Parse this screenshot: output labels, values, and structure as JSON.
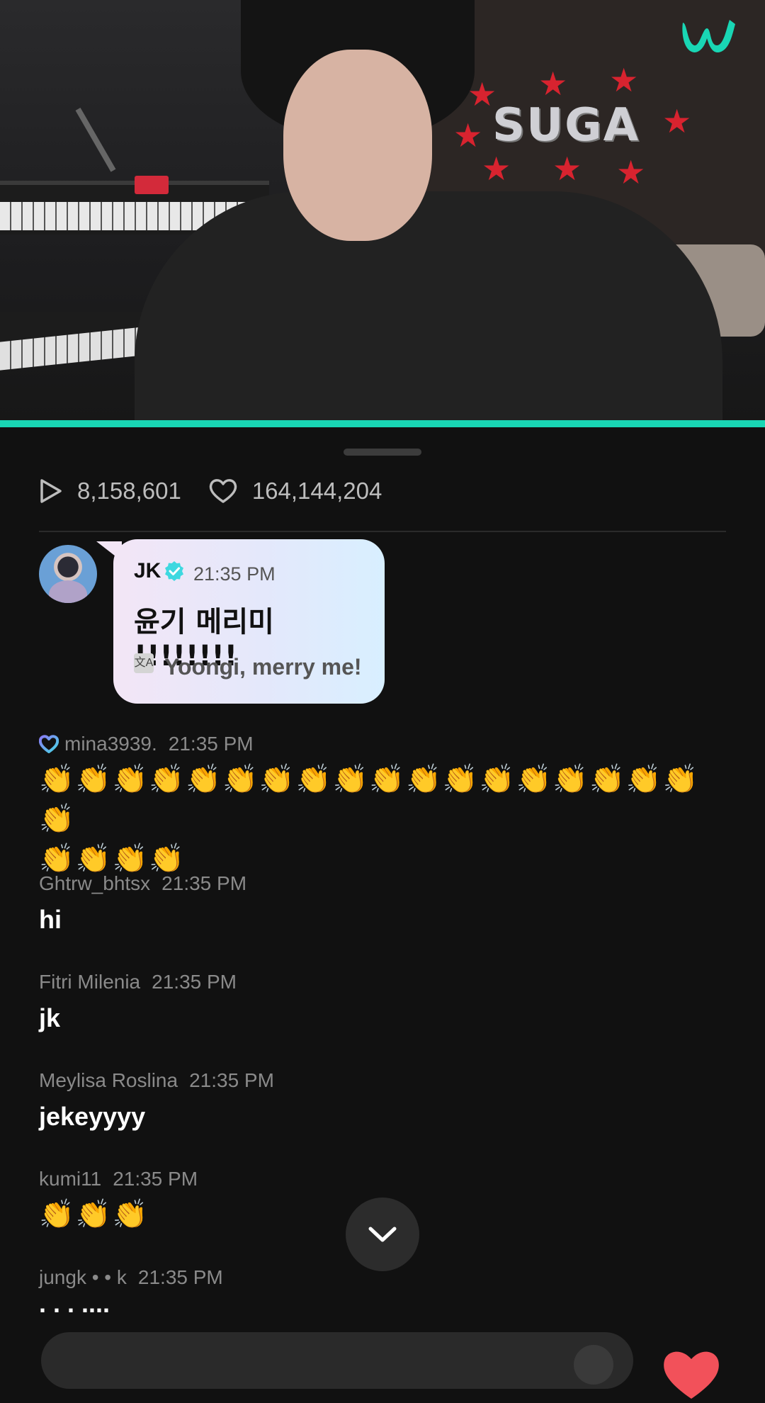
{
  "video": {
    "wall_text": "SUGA",
    "progress_fraction": 1.0,
    "accent_color": "#19d6b4"
  },
  "stats": {
    "views_icon": "play-icon",
    "views": "8,158,601",
    "likes_icon": "heart-icon",
    "likes": "164,144,204"
  },
  "artist_message": {
    "name": "JK",
    "time": "21:35 PM",
    "message": "윤기 메리미 !!!!!!!!",
    "translation_icon": "translate-icon",
    "translation": "Yoongi, merry me!"
  },
  "chat": [
    {
      "user": "mina3939.",
      "time": "21:35 PM",
      "text": "👏👏👏👏👏👏👏👏👏👏👏👏👏👏👏👏👏👏👏",
      "text2": "👏👏👏👏"
    },
    {
      "user": "Ghtrw_bhtsx",
      "time": "21:35 PM",
      "text": "hi"
    },
    {
      "user": "Fitri Milenia",
      "time": "21:35 PM",
      "text": "jk"
    },
    {
      "user": "Meylisa Roslina",
      "time": "21:35 PM",
      "text": "jekeyyyy"
    },
    {
      "user": "kumi11",
      "time": "21:35 PM",
      "text": "👏👏👏"
    },
    {
      "user": "jungk • • k",
      "time": "21:35 PM",
      "text": ". . . ...."
    }
  ],
  "controls": {
    "scroll_icon": "chevron-down-icon",
    "heart_icon": "heart-icon"
  }
}
